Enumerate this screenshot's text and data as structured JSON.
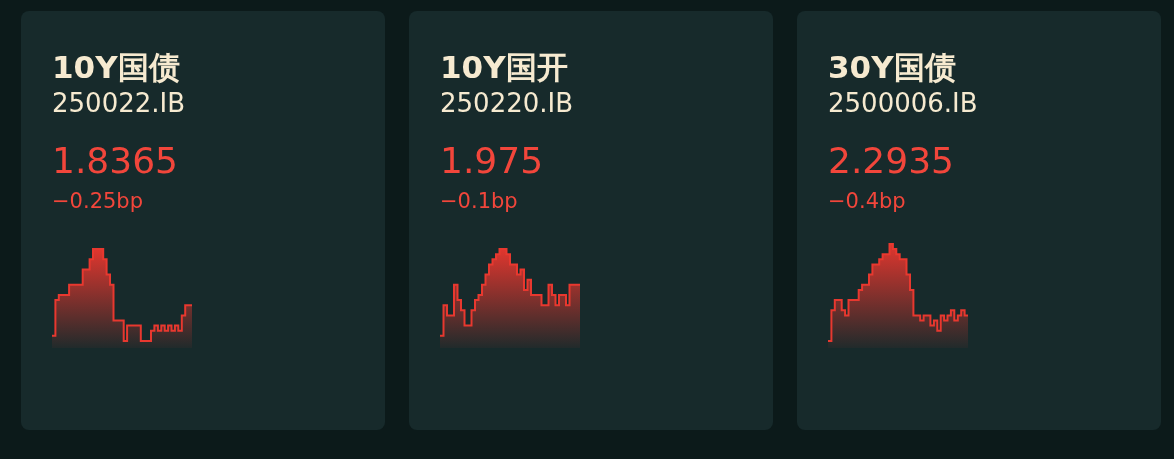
{
  "cards": [
    {
      "name": "10Y国债",
      "code": "250022.IB",
      "price": "1.8365",
      "change": "−0.25bp"
    },
    {
      "name": "10Y国开",
      "code": "250220.IB",
      "price": "1.975",
      "change": "−0.1bp"
    },
    {
      "name": "30Y国债",
      "code": "2500006.IB",
      "price": "2.2935",
      "change": "−0.4bp"
    }
  ]
}
